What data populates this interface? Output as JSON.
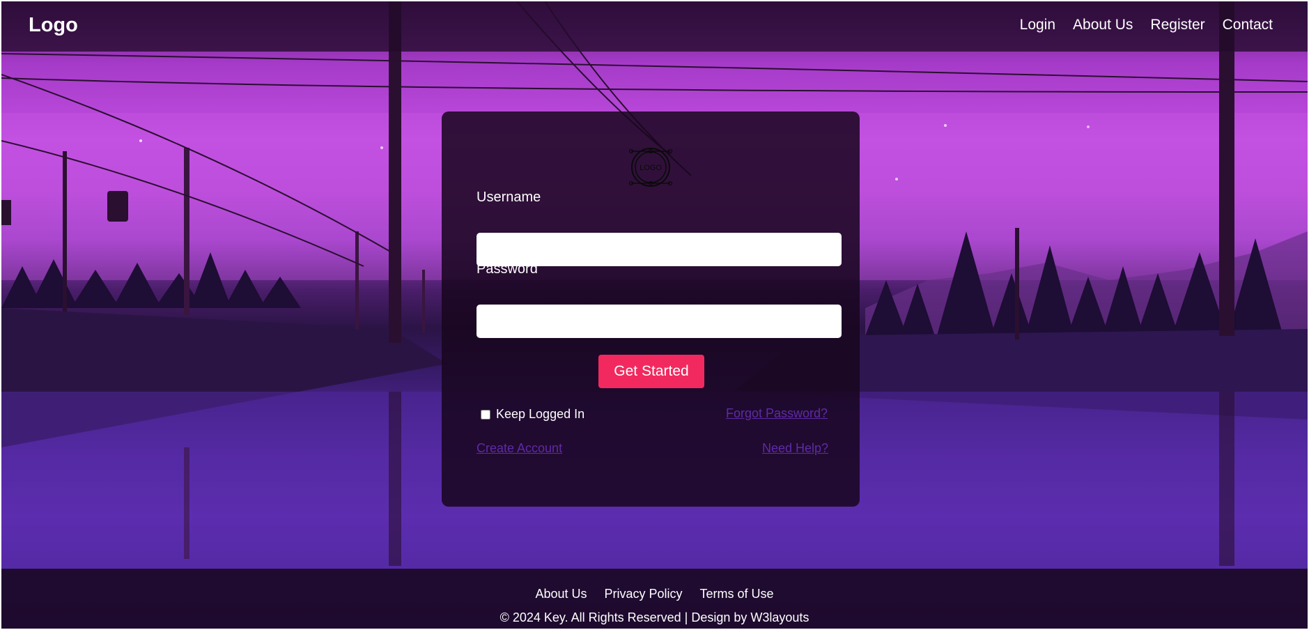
{
  "header": {
    "logo": "Logo",
    "nav": [
      "Login",
      "About Us",
      "Register",
      "Contact"
    ]
  },
  "form": {
    "logo_text": "LOGO",
    "username_label": "Username",
    "username_value": "",
    "password_label": "Password",
    "password_value": "",
    "submit_label": "Get Started",
    "remember_label": "Keep Logged In",
    "remember_checked": false,
    "forgot_label": "Forgot Password?",
    "create_label": "Create Account",
    "help_label": "Need Help?"
  },
  "footer": {
    "links": [
      "About Us",
      "Privacy Policy",
      "Terms of Use"
    ],
    "copyright": "© 2024 Key. All Rights Reserved | Design by W3layouts"
  },
  "colors": {
    "accent": "#f2295f",
    "link": "#5f2aa6",
    "bar": "#220a2c"
  }
}
